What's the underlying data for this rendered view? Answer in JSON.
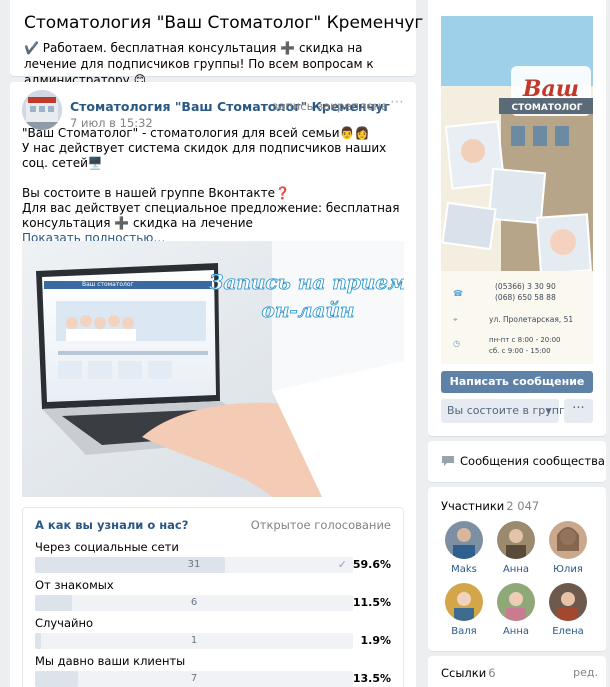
{
  "community": {
    "title": "Стоматология \"Ваш Стоматолог\" Кременчуг",
    "status": "✔️ Работаем. бесплатная консультация ➕ скидка на лечение для подписчиков группы! По всем вопросам к администратору 😊"
  },
  "post": {
    "author": "Стоматология \"Ваш Стоматолог\" Кременчуг",
    "pinned": "запись закреплена",
    "date": "7 июл в 15:32",
    "text_lines": [
      "\"Ваш Стоматолог\" - стоматология для всей семьи👨‍👩",
      "У нас действует система скидок для подписчиков наших соц. сетей🖥️",
      "",
      "Вы состоите в нашей группе Вконтакте❓",
      "Для вас действует специальное предложение: бесплатная консультация ➕ скидка на лечение"
    ],
    "show_more": "Показать полностью…",
    "image_caption_1": "Запись на прием",
    "image_caption_2": "он-лайн",
    "image_site_logo": "Ваш стоматолог"
  },
  "poll": {
    "question": "А как вы узнали о нас?",
    "type": "Открытое голосование",
    "options": [
      {
        "label": "Через социальные сети",
        "count": "31",
        "percent": "59.6%",
        "fraction": 0.596,
        "voted": true
      },
      {
        "label": "От знакомых",
        "count": "6",
        "percent": "11.5%",
        "fraction": 0.115,
        "voted": false
      },
      {
        "label": "Случайно",
        "count": "1",
        "percent": "1.9%",
        "fraction": 0.019,
        "voted": false
      },
      {
        "label": "Мы давно ваши клиенты",
        "count": "7",
        "percent": "13.5%",
        "fraction": 0.135,
        "voted": false
      }
    ]
  },
  "sidebar": {
    "cover": {
      "logo_big": "Ваш",
      "logo_small": "СТОМАТОЛОГ",
      "phone1": "(05366) 3 30 90",
      "phone2": "(068) 650 58 88",
      "address": "ул. Пролетарская, 51",
      "hours1": "пн-пт с 8:00 - 20:00",
      "hours2": "сб. с 9:00 - 15:00"
    },
    "write_button": "Написать сообщение",
    "member_button": "Вы состоите в группе",
    "more_button": "···",
    "messages_label": "Сообщения сообщества",
    "members_title": "Участники",
    "members_count": "2 047",
    "members": [
      {
        "name": "Maks"
      },
      {
        "name": "Анна"
      },
      {
        "name": "Юлия"
      },
      {
        "name": "Валя"
      },
      {
        "name": "Анна"
      },
      {
        "name": "Елена"
      }
    ],
    "links_title": "Ссылки",
    "links_count": "6",
    "links_edit": "ред."
  },
  "colors": {
    "link": "#2a5885",
    "button_primary": "#5e81a8",
    "button_secondary": "#e5ebf1",
    "page_bg": "#edeef0"
  }
}
